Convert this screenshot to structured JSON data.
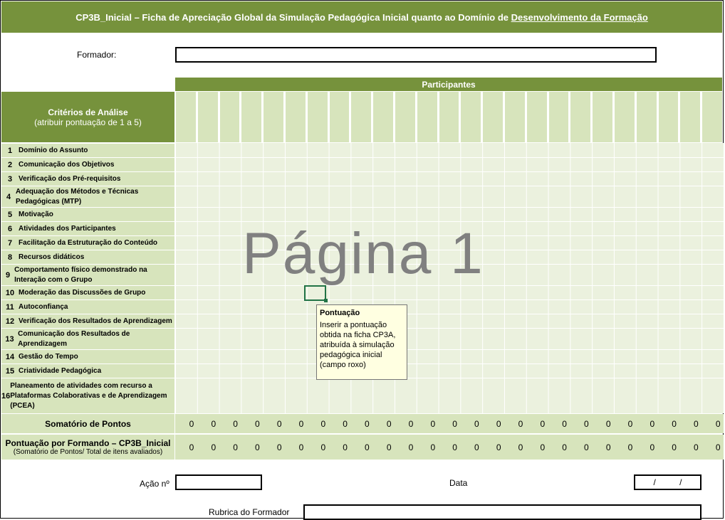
{
  "header": {
    "title_prefix": "CP3B_Inicial – Ficha de Apreciação Global da Simulação Pedagógica Inicial quanto ao Domínio de ",
    "title_underlined": "Desenvolvimento da Formação"
  },
  "formador": {
    "label": "Formador:",
    "value": ""
  },
  "table": {
    "participantes_label": "Participantes",
    "criteria_title": "Critérios de Análise",
    "criteria_subtitle": "(atribuir pontuação de 1 a 5)",
    "rows": [
      {
        "num": "1",
        "text": "Domínio do Assunto"
      },
      {
        "num": "2",
        "text": "Comunicação dos Objetivos"
      },
      {
        "num": "3",
        "text": "Verificação dos Pré-requisitos"
      },
      {
        "num": "4",
        "text": "Adequação dos Métodos e Técnicas Pedagógicas (MTP)"
      },
      {
        "num": "5",
        "text": "Motivação"
      },
      {
        "num": "6",
        "text": "Atividades dos Participantes"
      },
      {
        "num": "7",
        "text": "Facilitação da Estruturação do Conteúdo"
      },
      {
        "num": "8",
        "text": "Recursos didáticos"
      },
      {
        "num": "9",
        "text": "Comportamento físico demonstrado na Interação com o Grupo"
      },
      {
        "num": "10",
        "text": "Moderação das Discussões de Grupo"
      },
      {
        "num": "11",
        "text": "Autoconfiança"
      },
      {
        "num": "12",
        "text": "Verificação dos Resultados de Aprendizagem"
      },
      {
        "num": "13",
        "text": "Comunicação dos Resultados de Aprendizagem"
      },
      {
        "num": "14",
        "text": "Gestão do Tempo"
      },
      {
        "num": "15",
        "text": "Criatividade Pedagógica"
      },
      {
        "num": "16",
        "text": "Planeamento de atividades com recurso a Plataformas Colaborativas e de Aprendizagem (PCEA)"
      }
    ],
    "somatorio_label": "Somatório de Pontos",
    "pontuacao_label": "Pontuação por Formando – CP3B_Inicial",
    "pontuacao_sublabel": "(Somatório de Pontos/ Total de itens avaliados)",
    "somatorio_values": [
      "0",
      "0",
      "0",
      "0",
      "0",
      "0",
      "0",
      "0",
      "0",
      "0",
      "0",
      "0",
      "0",
      "0",
      "0",
      "0",
      "0",
      "0",
      "0",
      "0",
      "0",
      "0",
      "0",
      "0",
      "0"
    ],
    "pontuacao_values": [
      "0",
      "0",
      "0",
      "0",
      "0",
      "0",
      "0",
      "0",
      "0",
      "0",
      "0",
      "0",
      "0",
      "0",
      "0",
      "0",
      "0",
      "0",
      "0",
      "0",
      "0",
      "0",
      "0",
      "0",
      "0"
    ]
  },
  "watermark": "Página 1",
  "tooltip": {
    "title": "Pontuação",
    "body": "Inserir a pontuação obtida na ficha CP3A, atribuída à simulação pedagógica inicial (campo roxo)"
  },
  "footer": {
    "acao_label": "Ação nº",
    "acao_value": "",
    "data_label": "Data",
    "data_value": "/          /",
    "rubrica_label": "Rubrica do Formador",
    "rubrica_value": ""
  }
}
